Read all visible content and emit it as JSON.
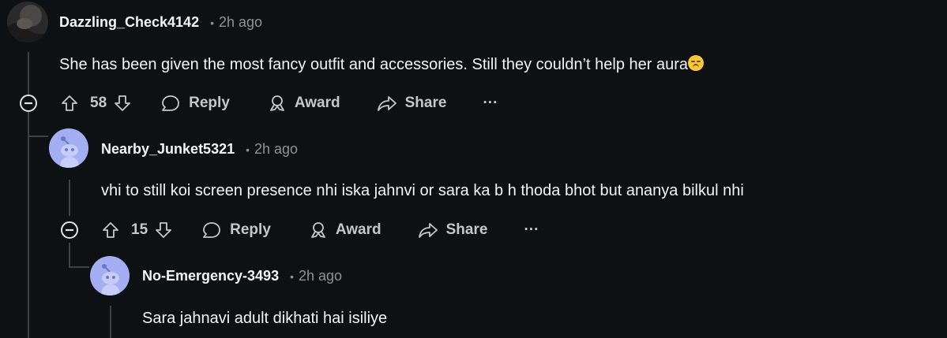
{
  "comments": [
    {
      "username": "Dazzling_Check4142",
      "time": "2h ago",
      "body": "She has been given the most fancy outfit and accessories. Still they couldn’t help her aura",
      "votes": "58",
      "actions": {
        "reply": "Reply",
        "award": "Award",
        "share": "Share",
        "more": "···"
      }
    },
    {
      "username": "Nearby_Junket5321",
      "time": "2h ago",
      "body": "vhi to still koi screen presence nhi iska jahnvi or sara ka b h thoda bhot but ananya bilkul nhi",
      "votes": "15",
      "actions": {
        "reply": "Reply",
        "award": "Award",
        "share": "Share",
        "more": "···"
      }
    },
    {
      "username": "No-Emergency-3493",
      "time": "2h ago",
      "body": "Sara jahnavi adult dikhati hai isiliye"
    }
  ],
  "meta_separator": "•",
  "colors": {
    "background": "#0e1113",
    "thread_line": "#3e4142",
    "avatar_blue": "#a3aef3",
    "text": "#f2f4f5",
    "muted": "#8b9396"
  },
  "icons": [
    "collapse-icon",
    "upvote-icon",
    "downvote-icon",
    "reply-icon",
    "award-icon",
    "share-icon",
    "overflow-menu-icon",
    "snoo-avatar-icon",
    "pensive-emoji-icon"
  ]
}
